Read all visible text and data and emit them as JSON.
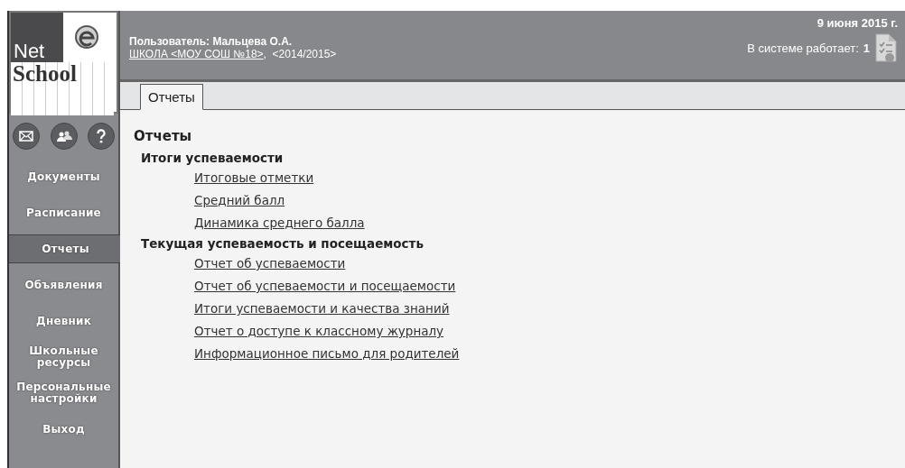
{
  "logo": {
    "word_1": "Net",
    "word_2": "School"
  },
  "header": {
    "user": "Пользователь: Мальцева О.А.",
    "school_link": "ШКОЛА <МОУ СОШ №18>",
    "year": ",  <2014/2015>",
    "date": "9 июня 2015 г.",
    "online_label": "В системе работает:",
    "online_count": "1"
  },
  "tabs": [
    {
      "label": "Отчеты",
      "selected": true
    }
  ],
  "sidebar": {
    "items": [
      {
        "label": "Документы",
        "selected": false
      },
      {
        "label": "Расписание",
        "selected": false
      },
      {
        "label": "Отчеты",
        "selected": true
      },
      {
        "label": "Объявления",
        "selected": false
      },
      {
        "label": "Дневник",
        "selected": false
      },
      {
        "label": "Школьные ресурсы",
        "selected": false
      },
      {
        "label": "Персональные настройки",
        "selected": false
      },
      {
        "label": "Выход",
        "selected": false
      }
    ]
  },
  "content": {
    "title": "Отчеты",
    "sections": [
      {
        "heading": "Итоги успеваемости",
        "links": [
          "Итоговые отметки",
          "Средний балл",
          "Динамика среднего балла"
        ]
      },
      {
        "heading": "Текущая успеваемость и посещаемость",
        "links": [
          "Отчет об успеваемости",
          "Отчет об успеваемости и посещаемости",
          "Итоги успеваемости и качества знаний",
          "Отчет о доступе к классному журналу",
          "Информационное письмо для родителей"
        ]
      }
    ]
  }
}
